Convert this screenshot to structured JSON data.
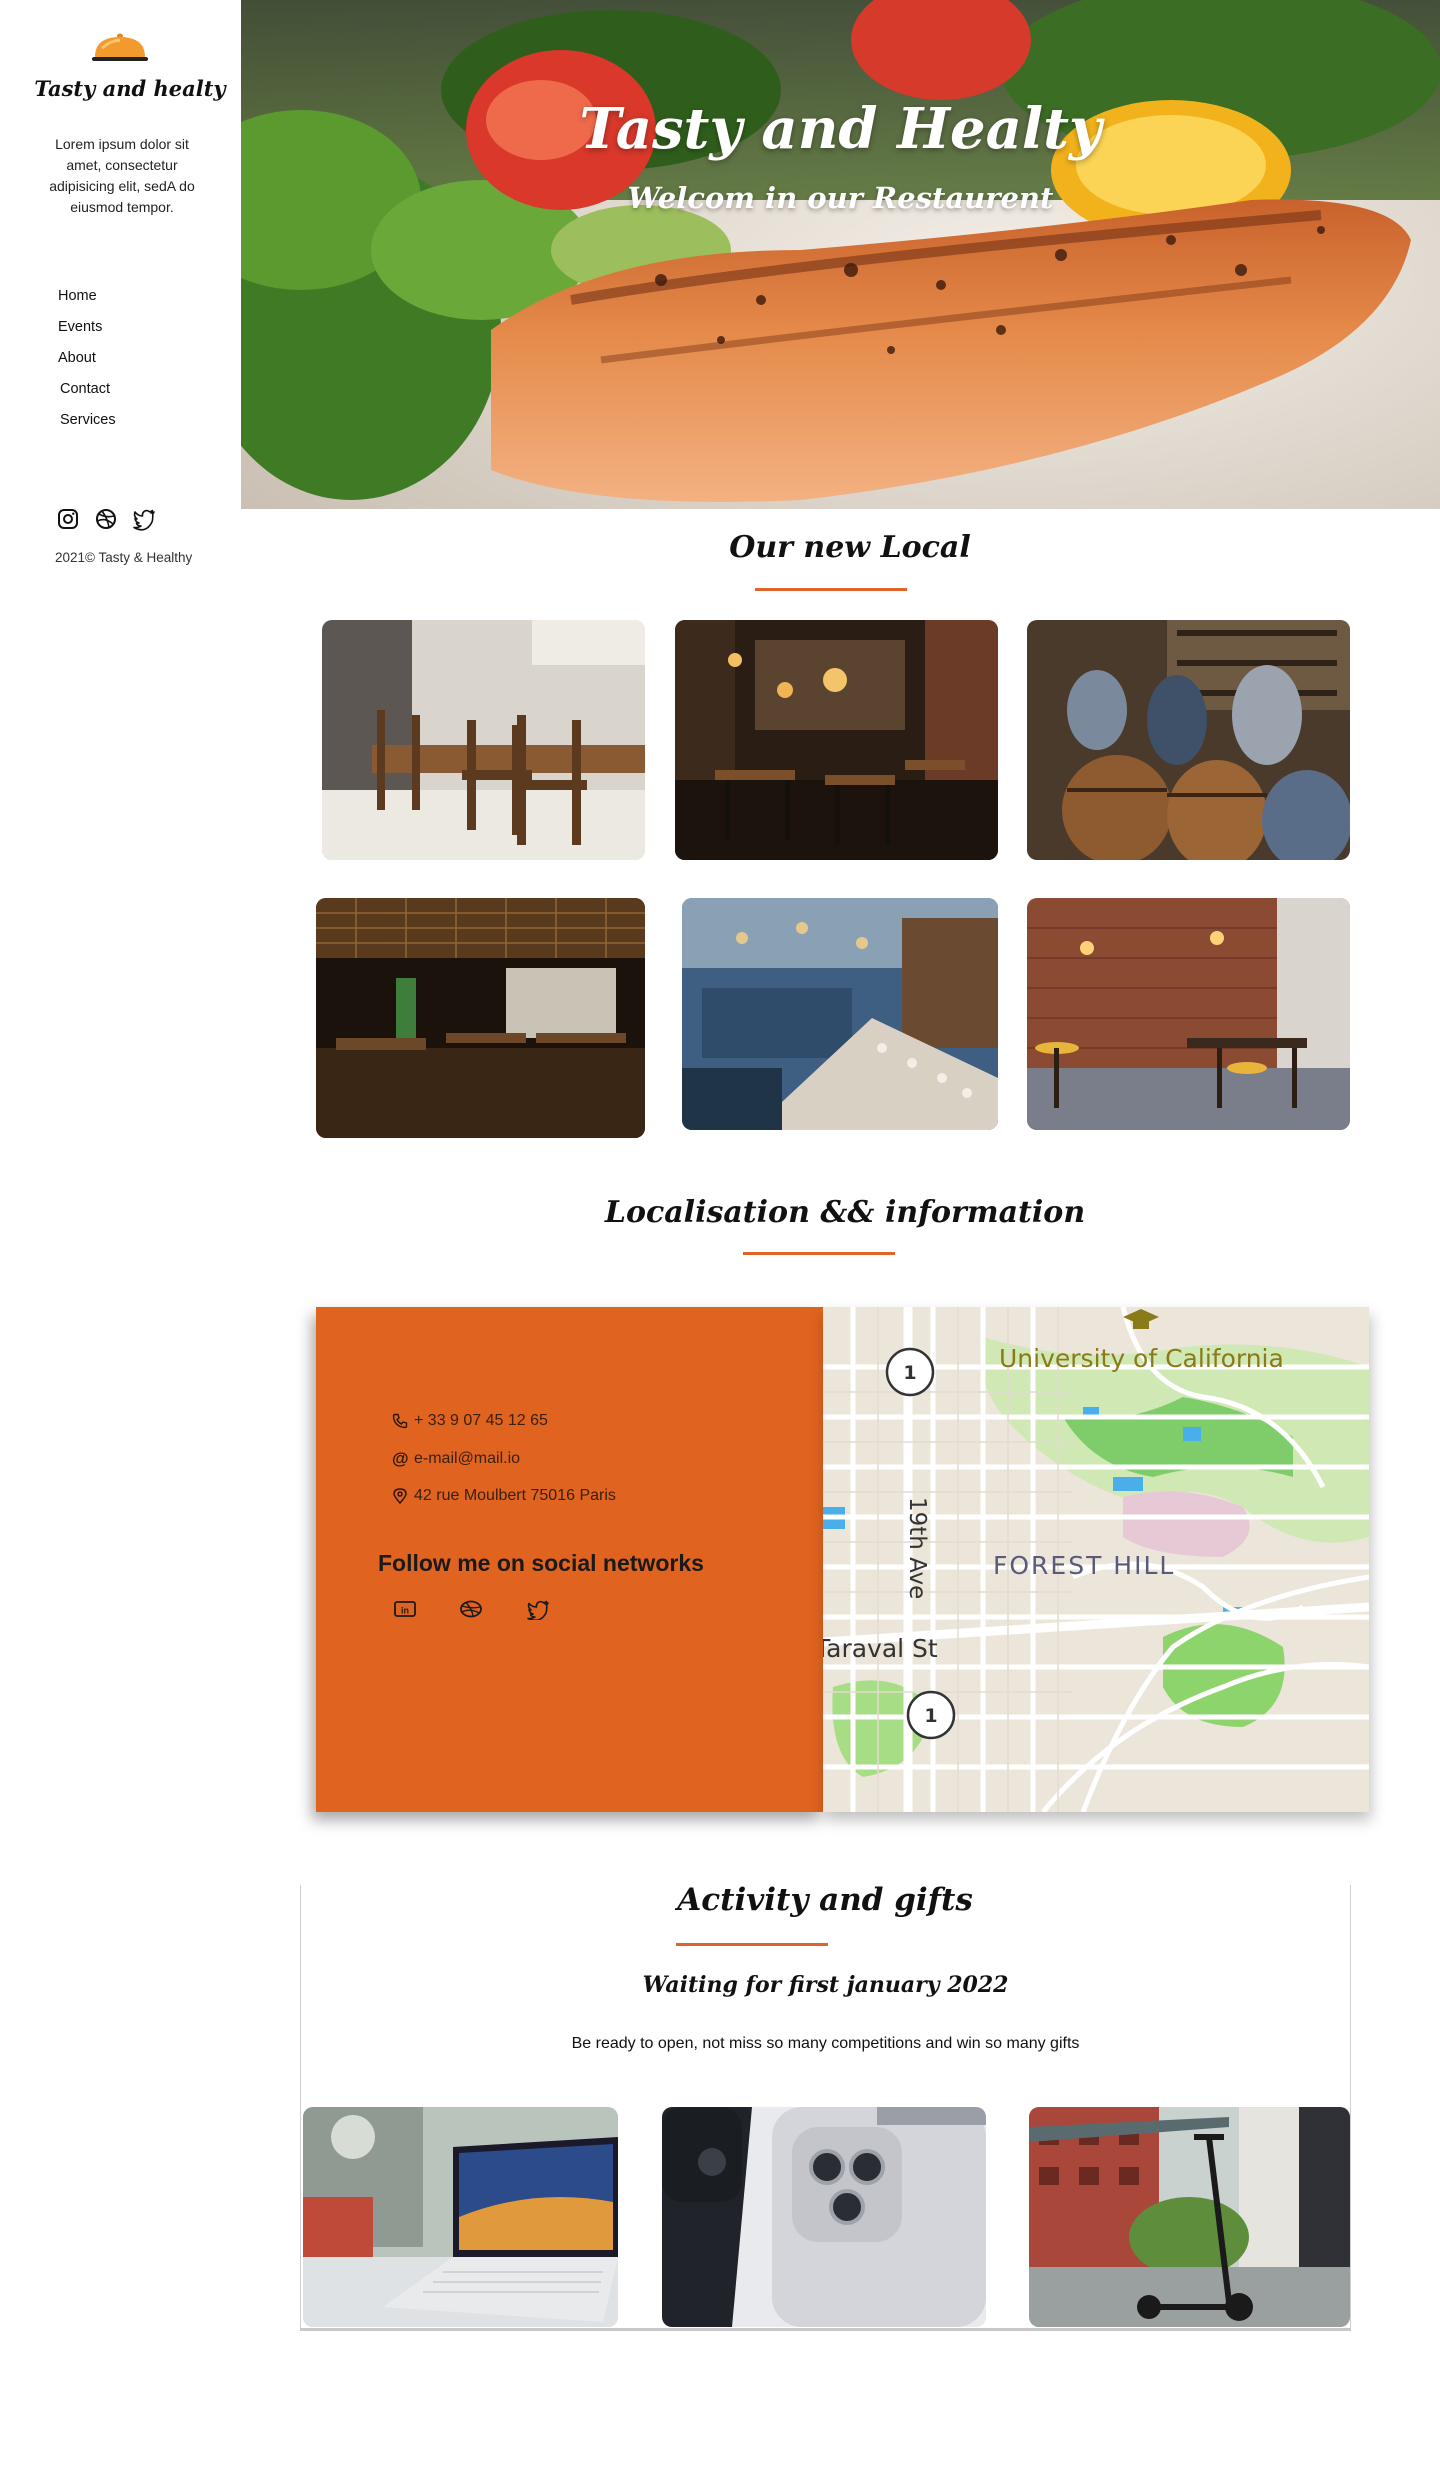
{
  "brand": {
    "name": "Tasty and healty",
    "intro": "Lorem ipsum dolor sit amet, consectetur adipisicing elit, sedA do eiusmod tempor."
  },
  "nav": {
    "items": [
      "Home",
      "Events",
      "About",
      "Contact",
      "Services"
    ]
  },
  "sidebar_social_icons": [
    "instagram-icon",
    "dribbble-icon",
    "twitter-icon"
  ],
  "copyright": "2021© Tasty & Healthy",
  "hero": {
    "title": "Tasty and Healty",
    "subtitle": "Welcom in our Restaurent"
  },
  "local": {
    "title": "Our new  Local"
  },
  "localisation": {
    "title": "Localisation && information",
    "phone": "+ 33 9 07 45 12 65",
    "email": "e-mail@mail.io",
    "address": "42 rue Moulbert 75016 Paris",
    "follow_title": "Follow me on social networks",
    "follow_icons": [
      "linkedin-icon",
      "dribbble-icon",
      "twitter-icon"
    ]
  },
  "map": {
    "labels": [
      "University of California",
      "19th Ave",
      "FOREST HILL",
      "Taraval St"
    ],
    "markers": [
      "1",
      "1"
    ]
  },
  "activity": {
    "title": "Activity and gifts",
    "waiting": "Waiting for first january 2022",
    "text": "Be ready to open, not miss so many competitions and win so many gifts"
  },
  "colors": {
    "accent": "#e0642a",
    "panel": "#e0631f"
  }
}
